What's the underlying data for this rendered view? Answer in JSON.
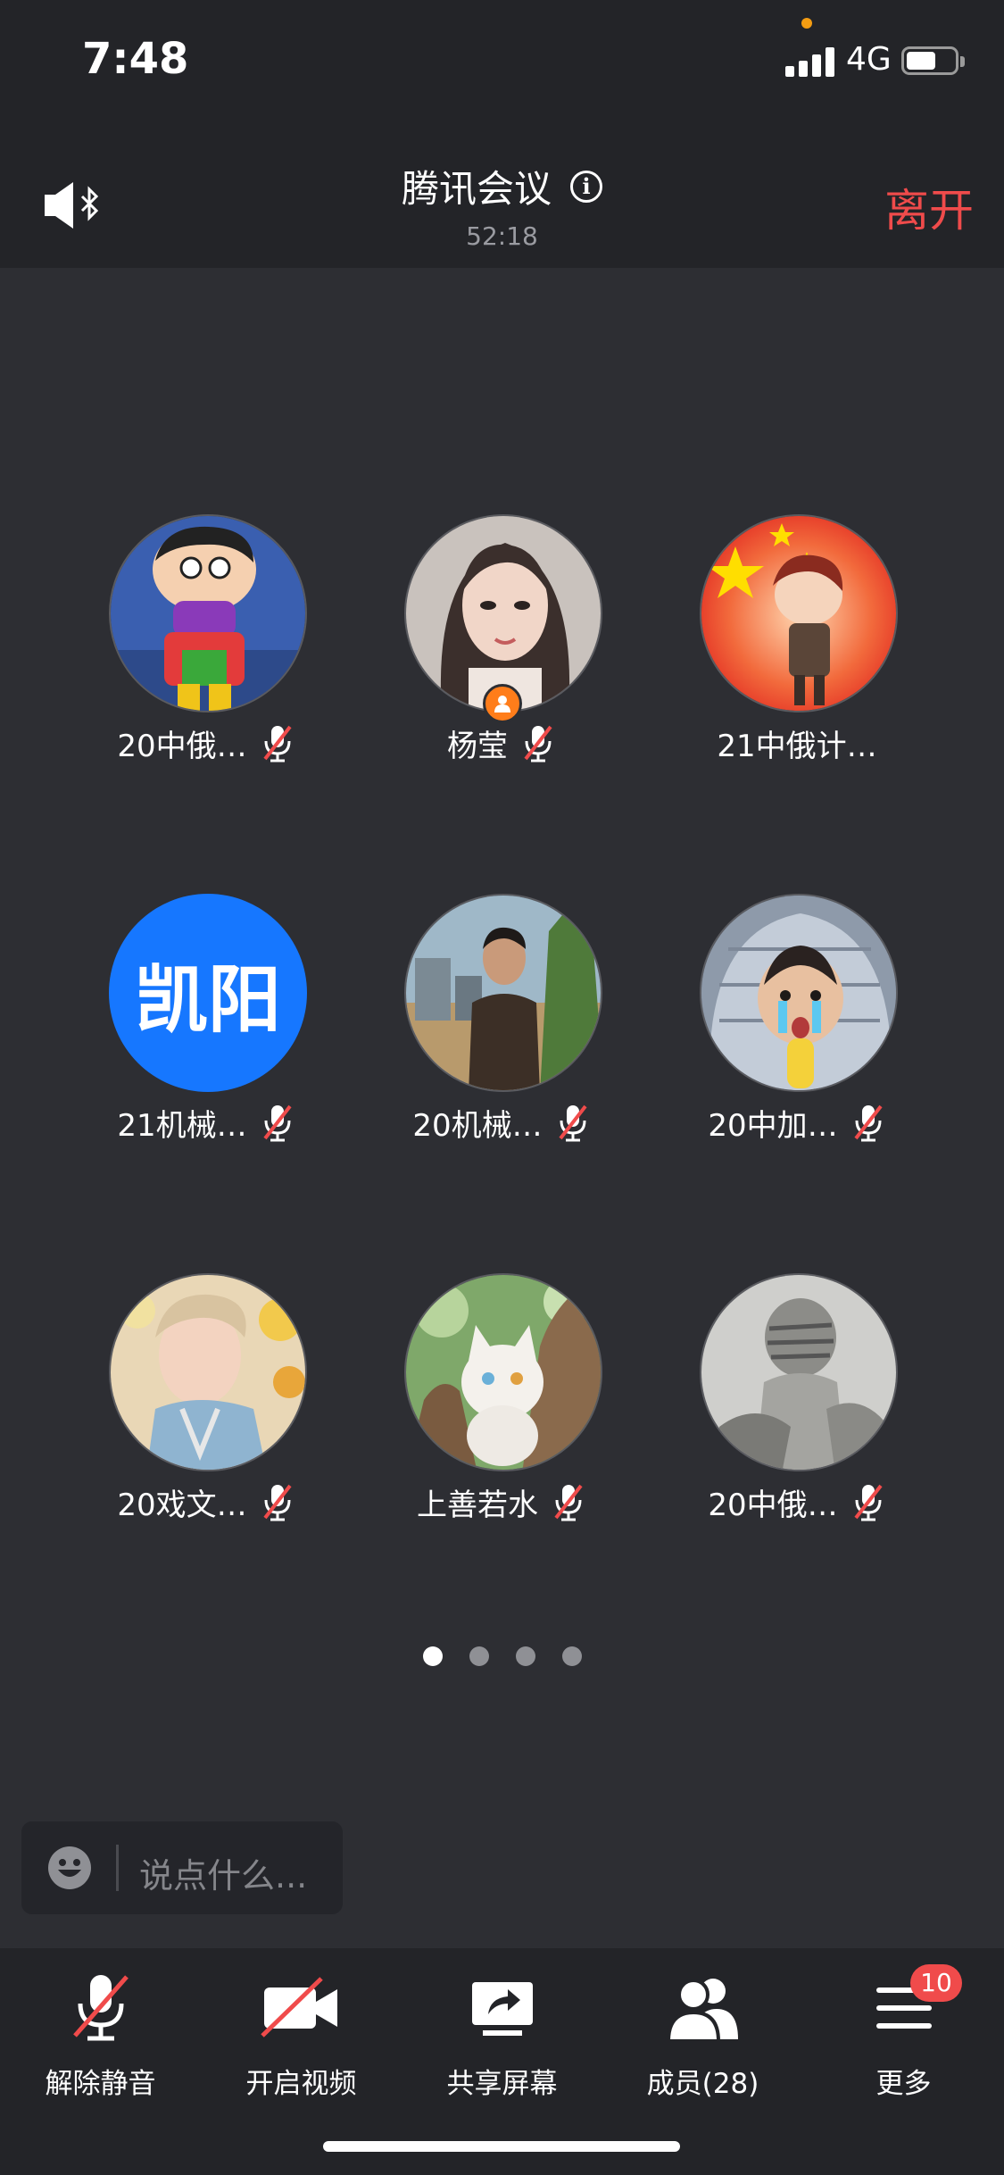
{
  "status_bar": {
    "time": "7:48",
    "network": "4G"
  },
  "header": {
    "title": "腾讯会议",
    "duration": "52:18",
    "leave_label": "离开",
    "info_glyph": "i"
  },
  "participants": [
    {
      "name": "20中俄…",
      "avatar": "cartoon-boy",
      "muted": true
    },
    {
      "name": "杨莹",
      "avatar": "woman-illustration",
      "muted": true,
      "host": true
    },
    {
      "name": "21中俄计…",
      "avatar": "flag-chibi",
      "muted": false
    },
    {
      "name": "21机械…",
      "avatar_text": "凯阳",
      "muted": true
    },
    {
      "name": "20机械…",
      "avatar": "man-outdoors",
      "muted": true
    },
    {
      "name": "20中加…",
      "avatar": "kid-blanket",
      "muted": true
    },
    {
      "name": "20戏文…",
      "avatar": "flowers-portrait",
      "muted": true
    },
    {
      "name": "上善若水",
      "avatar": "white-cat",
      "muted": true
    },
    {
      "name": "20中俄…",
      "avatar": "sketch-figure",
      "muted": true
    }
  ],
  "pagination": {
    "pages": 4,
    "current": 1
  },
  "chat": {
    "placeholder": "说点什么..."
  },
  "toolbar": {
    "unmute_label": "解除静音",
    "video_label": "开启视频",
    "share_label": "共享屏幕",
    "members_label": "成员(28)",
    "more_label": "更多",
    "more_badge": "10"
  },
  "colors": {
    "accent": "#1677ff",
    "danger": "#f04b4b",
    "host": "#ff7d1a"
  }
}
